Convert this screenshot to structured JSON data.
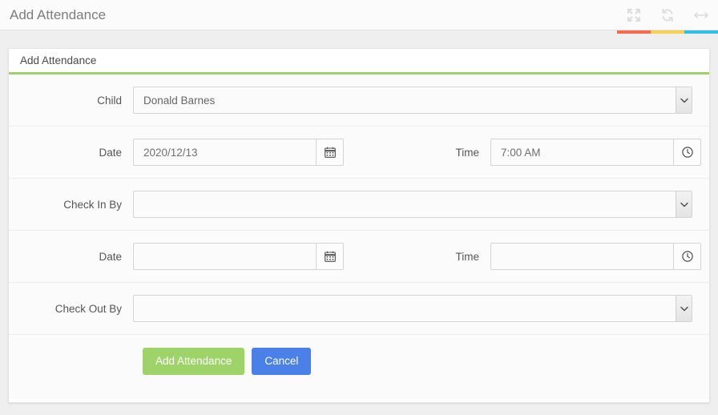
{
  "topbar": {
    "title": "Add Attendance",
    "icons": [
      {
        "name": "expand-icon",
        "accent": "#f9694c"
      },
      {
        "name": "refresh-icon",
        "accent": "#fcd04f"
      },
      {
        "name": "resize-icon",
        "accent": "#2fc0e8"
      }
    ]
  },
  "panel": {
    "title": "Add Attendance",
    "accent_color": "#9dd16b"
  },
  "form": {
    "child": {
      "label": "Child",
      "value": "Donald Barnes",
      "placeholder": ""
    },
    "checkin_date": {
      "label": "Date",
      "value": "2020/12/13",
      "placeholder": ""
    },
    "checkin_time": {
      "label": "Time",
      "value": "7:00 AM",
      "placeholder": ""
    },
    "checkin_by": {
      "label": "Check In By",
      "value": "",
      "placeholder": ""
    },
    "checkout_date": {
      "label": "Date",
      "value": "",
      "placeholder": ""
    },
    "checkout_time": {
      "label": "Time",
      "value": "",
      "placeholder": ""
    },
    "checkout_by": {
      "label": "Check Out By",
      "value": "",
      "placeholder": ""
    }
  },
  "actions": {
    "submit_label": "Add Attendance",
    "cancel_label": "Cancel",
    "submit_color": "#9ed36a",
    "cancel_color": "#4a80e8"
  }
}
